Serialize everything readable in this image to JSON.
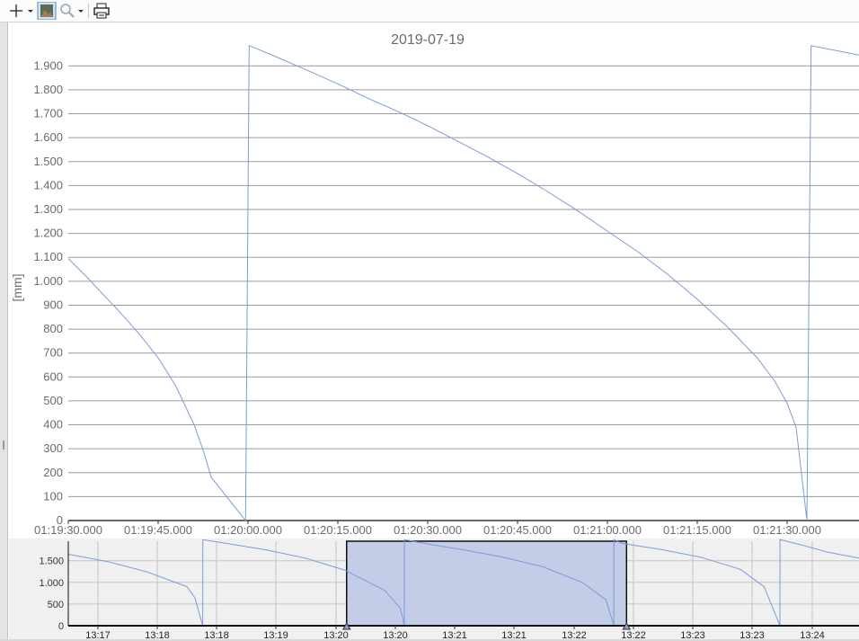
{
  "toolbar": {
    "buttons": [
      {
        "name": "crosshair-tool-button",
        "icon": "crosshair-icon"
      },
      {
        "name": "crosshair-dropdown-button",
        "icon": "chevron-down-icon"
      },
      {
        "name": "screenshot-button",
        "icon": "picture-icon"
      },
      {
        "name": "zoom-tool-button",
        "icon": "magnifier-icon"
      },
      {
        "name": "zoom-dropdown-button",
        "icon": "chevron-down-icon"
      },
      {
        "name": "print-button",
        "icon": "printer-icon"
      }
    ]
  },
  "colors": {
    "series": "#7b9bd8",
    "grid": "#9a9a9a",
    "text": "#6b6b6b",
    "selection": "#c3cde8",
    "nav_background": "#f0f0f0"
  },
  "chart_data": [
    {
      "type": "line",
      "title": "2019-07-19",
      "ylabel": "[mm]",
      "xlabel": "",
      "x_unit": "time of day",
      "ylim": [
        0,
        1950
      ],
      "xlim": [
        "01:19:30.000",
        "01:21:42.000"
      ],
      "y_ticks": [
        0,
        100,
        200,
        300,
        400,
        500,
        600,
        700,
        800,
        900,
        1000,
        1100,
        1200,
        1300,
        1400,
        1500,
        1600,
        1700,
        1800,
        1900
      ],
      "y_tick_labels": [
        "0",
        "100",
        "200",
        "300",
        "400",
        "500",
        "600",
        "700",
        "800",
        "900",
        "1.000",
        "1.100",
        "1.200",
        "1.300",
        "1.400",
        "1.500",
        "1.600",
        "1.700",
        "1.800",
        "1.900"
      ],
      "x_tick_labels": [
        "01:19:30.000",
        "01:19:45.000",
        "01:20:00.000",
        "01:20:15.000",
        "01:20:30.000",
        "01:20:45.000",
        "01:21:00.000",
        "01:21:15.000",
        "01:21:30.000"
      ],
      "x_tick_seconds": [
        0,
        15,
        30,
        45,
        60,
        75,
        90,
        105,
        120
      ],
      "grid": "horizontal",
      "series": [
        {
          "x": [
            0,
            3,
            6,
            9,
            12,
            15,
            18,
            21,
            22.5,
            23.9,
            29.6,
            30.2,
            35,
            40,
            45,
            50,
            55,
            60,
            65,
            70,
            75,
            80,
            85,
            90,
            95,
            100,
            105,
            110,
            115,
            118,
            120,
            121.5,
            123.3,
            124,
            132
          ],
          "y": [
            1095,
            1020,
            940,
            860,
            775,
            680,
            560,
            400,
            295,
            180,
            0,
            1985,
            1935,
            1880,
            1825,
            1765,
            1710,
            1650,
            1585,
            1520,
            1450,
            1375,
            1295,
            1210,
            1125,
            1030,
            925,
            810,
            680,
            580,
            490,
            390,
            0,
            1985,
            1945
          ]
        }
      ]
    },
    {
      "type": "area",
      "title": "",
      "ylim": [
        0,
        1950
      ],
      "y_ticks": [
        0,
        500,
        1000,
        1500
      ],
      "y_tick_labels": [
        "0",
        "500",
        "1.000",
        "1.500"
      ],
      "x_tick_labels": [
        "13:17",
        "13:18",
        "13:19",
        "13:20",
        "13:20",
        "13:21",
        "13:21",
        "13:22",
        "13:22",
        "13:23",
        "13:23"
      ],
      "x_tick_positions": [
        109,
        175,
        241,
        307,
        374,
        440,
        506,
        572,
        639,
        705,
        771,
        837,
        904
      ],
      "x_tick_labels_all": [
        "13:17",
        "13:18",
        "13:18",
        "13:19",
        "13:20",
        "13:20",
        "13:21",
        "13:21",
        "13:22",
        "13:22",
        "13:23",
        "13:23",
        "13:24"
      ],
      "selection": {
        "from": 0.352,
        "to": 0.706
      },
      "series": [
        {
          "x": [
            0,
            0.05,
            0.1,
            0.15,
            0.16,
            0.17,
            0.1701,
            0.2,
            0.25,
            0.3,
            0.35,
            0.4,
            0.42,
            0.425,
            0.4251,
            0.45,
            0.5,
            0.55,
            0.6,
            0.65,
            0.68,
            0.69,
            0.6901,
            0.7,
            0.75,
            0.8,
            0.85,
            0.88,
            0.9,
            0.9001,
            0.93,
            0.96,
            1.0
          ],
          "y": [
            1650,
            1480,
            1240,
            900,
            650,
            0,
            1985,
            1900,
            1750,
            1560,
            1280,
            820,
            400,
            0,
            1985,
            1900,
            1750,
            1580,
            1360,
            1000,
            600,
            0,
            1985,
            1900,
            1760,
            1580,
            1300,
            900,
            0,
            1985,
            1850,
            1700,
            1560
          ]
        }
      ]
    }
  ]
}
